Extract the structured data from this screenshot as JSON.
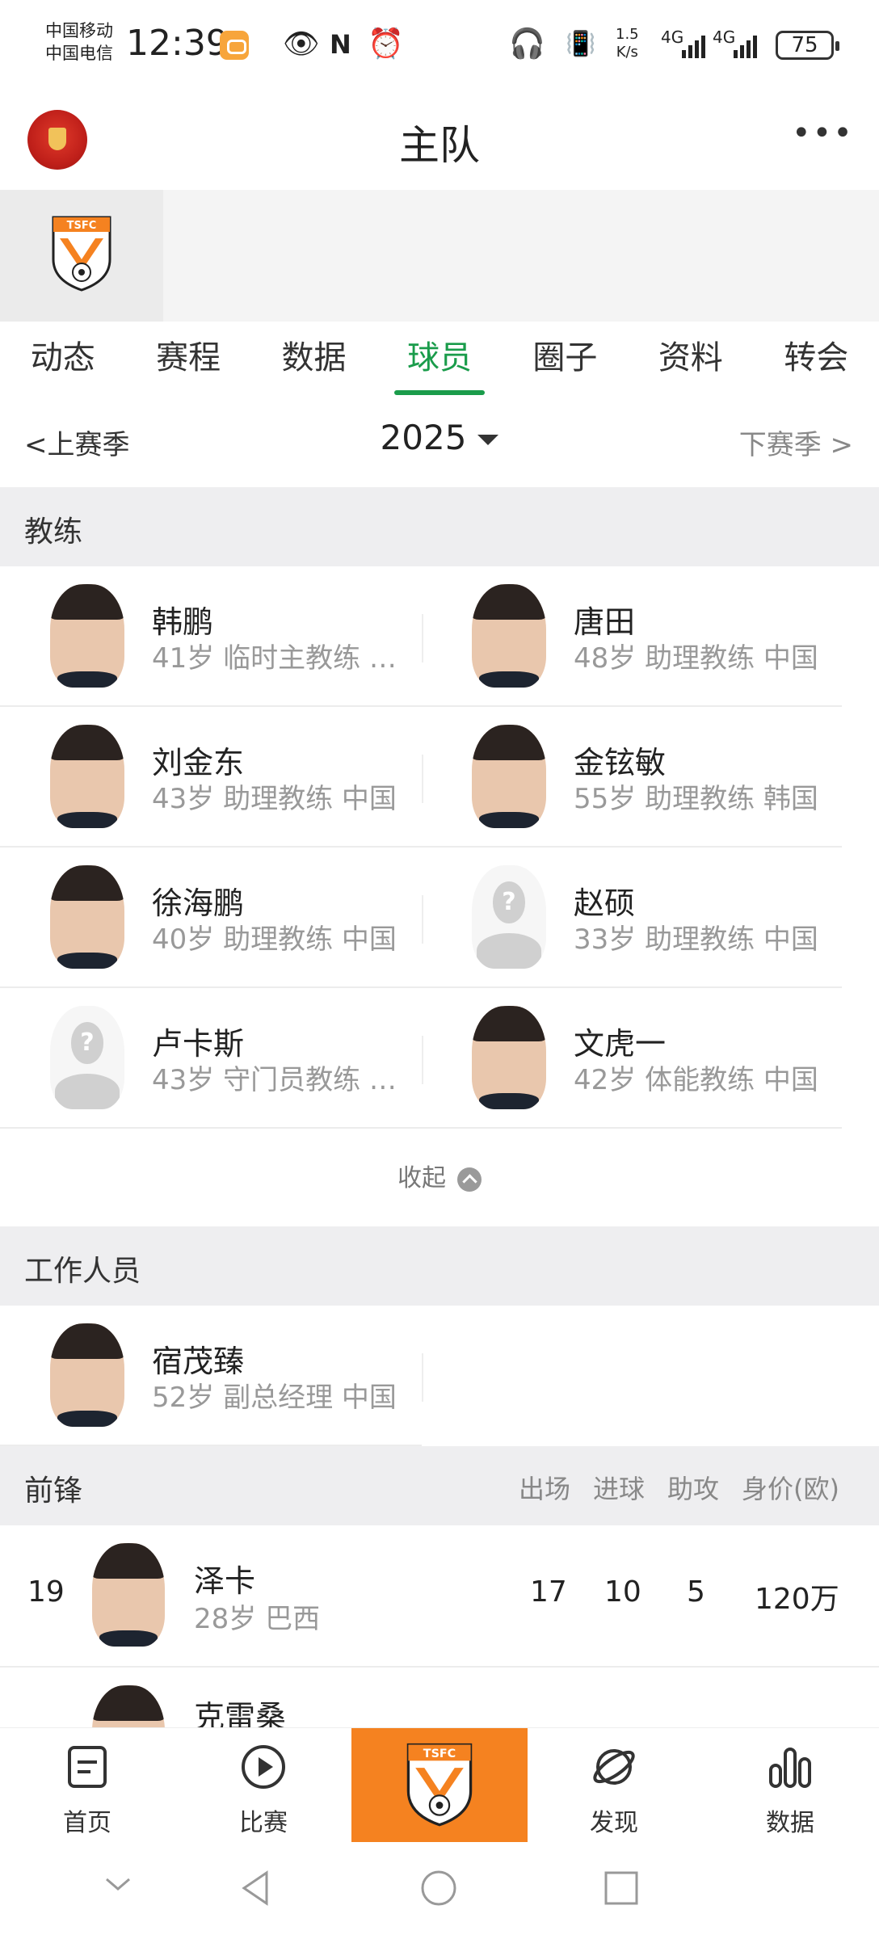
{
  "status_bar": {
    "carrier_1": "中国移动",
    "carrier_2": "中国电信",
    "time": "12:39",
    "net_speed_value": "1.5",
    "net_speed_unit": "K/s",
    "network_1": "4G",
    "network_2": "4G",
    "battery": "75"
  },
  "header": {
    "title": "主队"
  },
  "tabs": [
    {
      "label": "动态",
      "active": false
    },
    {
      "label": "赛程",
      "active": false
    },
    {
      "label": "数据",
      "active": false
    },
    {
      "label": "球员",
      "active": true
    },
    {
      "label": "圈子",
      "active": false
    },
    {
      "label": "资料",
      "active": false
    },
    {
      "label": "转会",
      "active": false
    }
  ],
  "season": {
    "prev_label": "上赛季",
    "year": "2025",
    "next_label": "下赛季"
  },
  "coaches": {
    "title": "教练",
    "items": [
      {
        "name": "韩鹏",
        "meta": "41岁 临时主教练 …",
        "photo": "real"
      },
      {
        "name": "唐田",
        "meta": "48岁 助理教练 中国",
        "photo": "real"
      },
      {
        "name": "刘金东",
        "meta": "43岁 助理教练 中国",
        "photo": "real"
      },
      {
        "name": "金铉敏",
        "meta": "55岁 助理教练 韩国",
        "photo": "real"
      },
      {
        "name": "徐海鹏",
        "meta": "40岁 助理教练 中国",
        "photo": "real"
      },
      {
        "name": "赵硕",
        "meta": "33岁 助理教练 中国",
        "photo": "placeholder"
      },
      {
        "name": "卢卡斯",
        "meta": "43岁 守门员教练 …",
        "photo": "placeholder"
      },
      {
        "name": "文虎一",
        "meta": "42岁 体能教练 中国",
        "photo": "real"
      }
    ],
    "collapse_label": "收起"
  },
  "staff": {
    "title": "工作人员",
    "items": [
      {
        "name": "宿茂臻",
        "meta": "52岁 副总经理 中国",
        "photo": "real"
      }
    ]
  },
  "forwards": {
    "title": "前锋",
    "columns": [
      "出场",
      "进球",
      "助攻",
      "身价(欧)"
    ],
    "players": [
      {
        "number": "19",
        "name": "泽卡",
        "meta": "28岁 巴西",
        "apps": "17",
        "goals": "10",
        "assists": "5",
        "value": "120万"
      },
      {
        "number": "",
        "name": "克雷桑",
        "meta": "",
        "apps": "",
        "goals": "",
        "assists": "",
        "value": ""
      }
    ]
  },
  "bottom_nav": {
    "items": [
      {
        "label": "首页",
        "icon": "document-icon"
      },
      {
        "label": "比赛",
        "icon": "play-icon"
      },
      {
        "label": "",
        "icon": "team-crest-icon"
      },
      {
        "label": "发现",
        "icon": "planet-icon"
      },
      {
        "label": "数据",
        "icon": "bar-chart-icon"
      }
    ]
  },
  "colors": {
    "accent_green": "#1a9c4b",
    "team_orange": "#f58220",
    "section_bg": "#eeeef0"
  }
}
